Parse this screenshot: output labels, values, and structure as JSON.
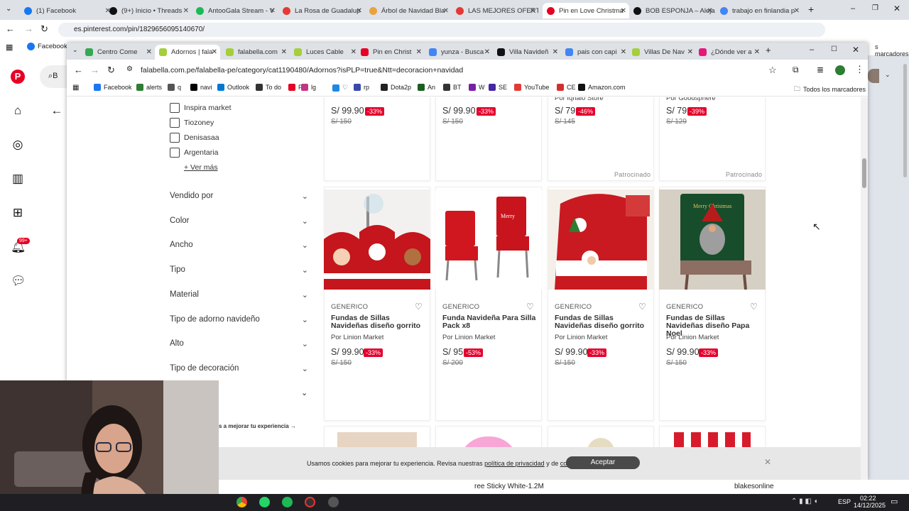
{
  "outer_browser": {
    "tabs": [
      {
        "label": "(1) Facebook",
        "color": "#1877f2"
      },
      {
        "label": "(9+) Inicio • Threads",
        "color": "#111111"
      },
      {
        "label": "AntooGala Stream - V",
        "color": "#1db954"
      },
      {
        "label": "La Rosa de Guadalup",
        "color": "#e53935"
      },
      {
        "label": "Árbol de Navidad Bla",
        "color": "#e8a33d"
      },
      {
        "label": "LAS MEJORES OFERTA",
        "color": "#e53935"
      },
      {
        "label": "Pin en Love Christma",
        "color": "#e60023"
      },
      {
        "label": "BOB ESPONJA – Aleja",
        "color": "#111111"
      },
      {
        "label": "trabajo en finlandia p",
        "color": "#4285f4"
      }
    ],
    "url": "es.pinterest.com/pin/1829656095140670/",
    "bookmark_first": "Facebook",
    "bookmark_right": "s marcadores"
  },
  "pinterest": {
    "badge": "99+",
    "search_letter": "B"
  },
  "inner_browser": {
    "tabs": [
      {
        "label": "Centro Come",
        "color": "#34a853"
      },
      {
        "label": "Adornos | fala",
        "color": "#a5cf3a"
      },
      {
        "label": "falabella.com",
        "color": "#a5cf3a"
      },
      {
        "label": "Luces Cable",
        "color": "#a5cf3a"
      },
      {
        "label": "Pin en Christ",
        "color": "#e60023"
      },
      {
        "label": "yunza - Busca",
        "color": "#4285f4"
      },
      {
        "label": "Villa Navideñ",
        "color": "#111111"
      },
      {
        "label": "pais con capi",
        "color": "#4285f4"
      },
      {
        "label": "Villas De Nav",
        "color": "#a5cf3a"
      },
      {
        "label": "¿Dónde ver a",
        "color": "#e6177b"
      }
    ],
    "url": "falabella.com.pe/falabella-pe/category/cat1190480/Adornos?isPLP=true&Ntt=decoracion+navidad",
    "bookmarks": [
      "Facebook",
      "alerts",
      "q",
      "navi",
      "Outlook",
      "To do",
      "P",
      "lg",
      "♡",
      "rp",
      "Dota2p",
      "An",
      "BT",
      "W",
      "SE",
      "YouTube",
      "CE",
      "Amazon.com"
    ],
    "all_bookmarks": "Todos los marcadores"
  },
  "filters": {
    "brands": [
      "Inspira market",
      "Tiozoney",
      "Denisasaa",
      "Argentaria"
    ],
    "see_more": "+ Ver más",
    "facets": [
      "Vendido por",
      "Color",
      "Ancho",
      "Tipo",
      "Material",
      "Tipo de adorno navideño",
      "Alto",
      "Tipo de decoración"
    ],
    "help_text": "s a mejorar tu experiencia"
  },
  "top_row": [
    {
      "price": "S/ 99.90",
      "discount": "-33%",
      "old": "S/ 150",
      "seller": "",
      "sponsored": ""
    },
    {
      "price": "S/ 99.90",
      "discount": "-33%",
      "old": "S/ 150",
      "seller": "",
      "sponsored": ""
    },
    {
      "price": "S/ 79",
      "discount": "-46%",
      "old": "S/ 145",
      "seller": "Por Iqhaio Store",
      "sponsored": "Patrocinado"
    },
    {
      "price": "S/ 79",
      "discount": "-39%",
      "old": "S/ 129",
      "seller": "Por Goodsphere",
      "sponsored": "Patrocinado"
    }
  ],
  "products": [
    {
      "brand": "GENERICO",
      "name": "Fundas de Sillas Navideñas diseño gorrito",
      "seller": "Por Linion Market",
      "price": "S/ 99.90",
      "discount": "-33%",
      "old": "S/ 150"
    },
    {
      "brand": "GENERICO",
      "name": "Funda Navideña Para Silla Pack x8",
      "seller": "Por Linion Market",
      "price": "S/ 95",
      "discount": "-53%",
      "old": "S/ 200"
    },
    {
      "brand": "GENERICO",
      "name": "Fundas de Sillas Navideñas diseño gorrito",
      "seller": "Por Linion Market",
      "price": "S/ 99.90",
      "discount": "-33%",
      "old": "S/ 150"
    },
    {
      "brand": "GENERICO",
      "name": "Fundas de Sillas Navideñas diseño Papa Noel",
      "seller": "Por Linion Market",
      "price": "S/ 99.90",
      "discount": "-33%",
      "old": "S/ 150"
    }
  ],
  "cookie": {
    "text_before": "Usamos cookies para mejorar tu experiencia. Revisa nuestras",
    "link1": "política de privacidad",
    "mid": "y de",
    "link2": "cookies.",
    "accept": "Aceptar"
  },
  "behind": {
    "text1": "ree Sticky White-1.2M",
    "text2": "blakesonline"
  },
  "taskbar": {
    "lang": "ESP",
    "time": "02:22",
    "date": "14/12/2025"
  }
}
